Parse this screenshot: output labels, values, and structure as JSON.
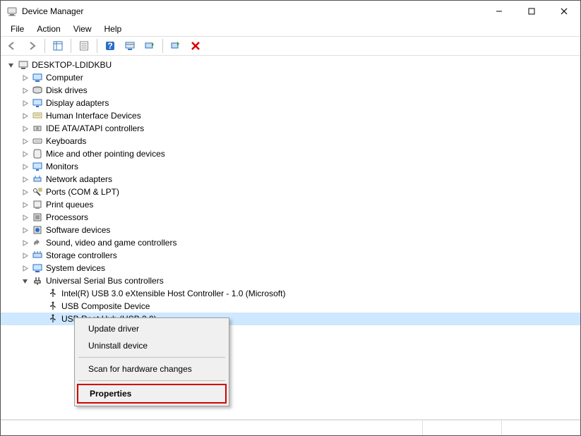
{
  "title": "Device Manager",
  "menus": {
    "file": "File",
    "action": "Action",
    "view": "View",
    "help": "Help"
  },
  "root": "DESKTOP-LDIDKBU",
  "categories": [
    "Computer",
    "Disk drives",
    "Display adapters",
    "Human Interface Devices",
    "IDE ATA/ATAPI controllers",
    "Keyboards",
    "Mice and other pointing devices",
    "Monitors",
    "Network adapters",
    "Ports (COM & LPT)",
    "Print queues",
    "Processors",
    "Software devices",
    "Sound, video and game controllers",
    "Storage controllers",
    "System devices",
    "Universal Serial Bus controllers"
  ],
  "usb_children": [
    "Intel(R) USB 3.0 eXtensible Host Controller - 1.0 (Microsoft)",
    "USB Composite Device",
    "USB Root Hub (USB 3.0)"
  ],
  "context_menu": {
    "update": "Update driver",
    "uninstall": "Uninstall device",
    "scan": "Scan for hardware changes",
    "properties": "Properties"
  }
}
